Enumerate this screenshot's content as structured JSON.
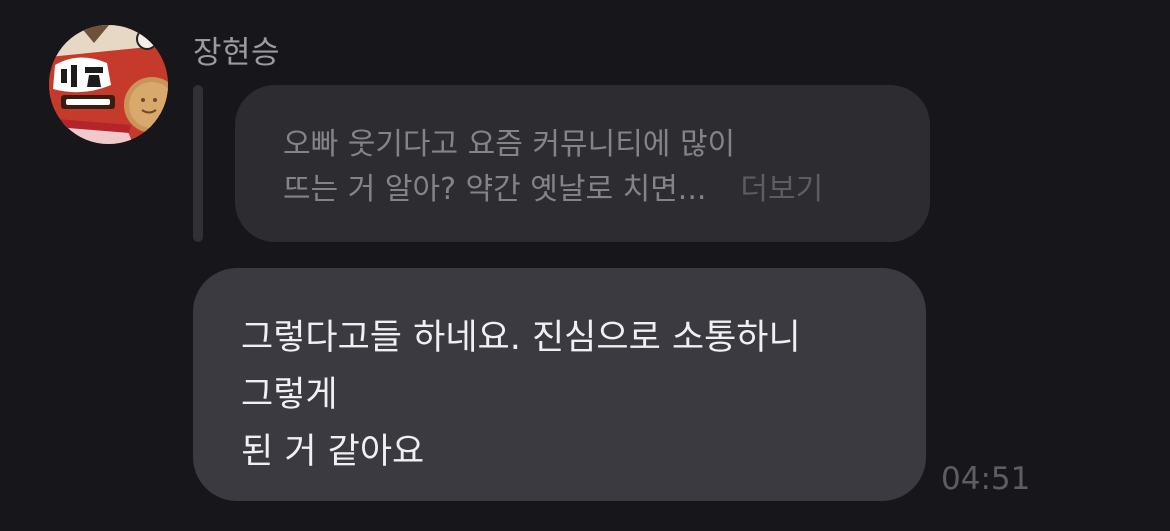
{
  "sender": {
    "name": "장현승"
  },
  "reply": {
    "lines": [
      "오빠 웃기다고 요즘 커뮤니티에 많이",
      "뜨는 거 알아? 약간 옛날로 치면..."
    ],
    "more_label": "더보기"
  },
  "message": {
    "lines": [
      "그렇다고들 하네요. 진심으로 소통하니",
      "그렇게",
      "된 거 같아요"
    ],
    "time": "04:51"
  },
  "colors": {
    "background": "#17171b",
    "reply_bubble": "#2c2c31",
    "message_bubble": "#3a3a40",
    "sender_text": "#9a9aa0",
    "reply_text": "#838389",
    "more_text": "#5c5c62",
    "time_text": "#5d5d63",
    "avatar_red": "#c63a2c"
  },
  "avatar": {
    "icon": "profile-photo"
  }
}
